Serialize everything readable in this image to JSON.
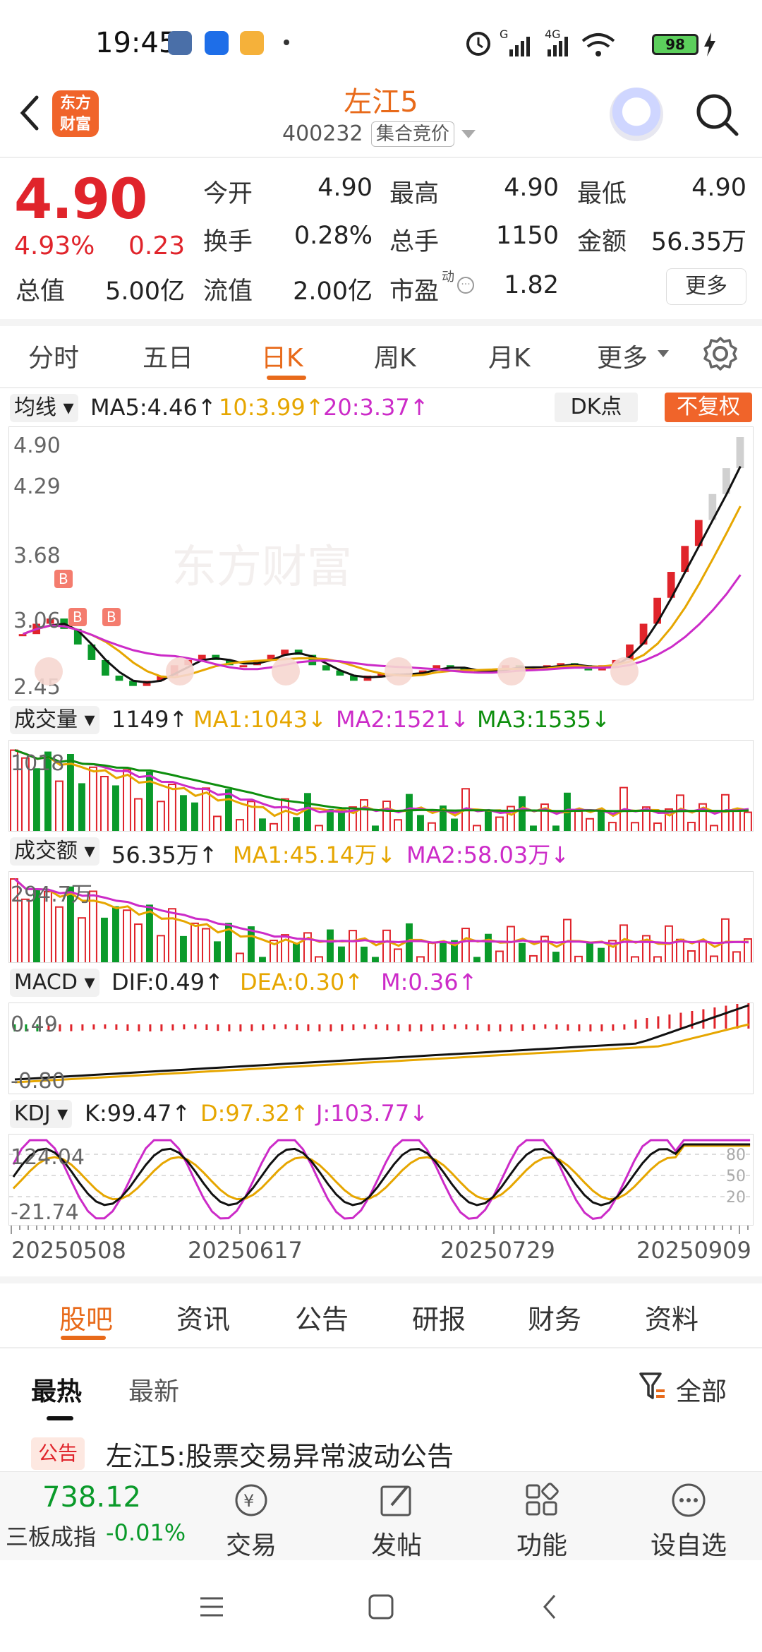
{
  "status_bar": {
    "time": "19:45",
    "battery": "98",
    "net1": "G",
    "net2": "4G"
  },
  "header": {
    "logo_text": [
      "东方",
      "财富"
    ],
    "stock_name": "左江5",
    "stock_code": "400232",
    "trading_mode": "集合竞价"
  },
  "quote": {
    "price": "4.90",
    "change_pct": "4.93%",
    "change_val": "0.23",
    "rows": [
      [
        {
          "label": "今开",
          "value": "4.90",
          "color": "red"
        },
        {
          "label": "最高",
          "value": "4.90",
          "color": "red"
        },
        {
          "label": "最低",
          "value": "4.90",
          "color": "red"
        }
      ],
      [
        {
          "label": "换手",
          "value": "0.28%",
          "color": "dark"
        },
        {
          "label": "总手",
          "value": "1150",
          "color": "dark"
        },
        {
          "label": "金额",
          "value": "56.35万",
          "color": "dark"
        }
      ]
    ],
    "total_value_label": "总值",
    "total_value": "5.00亿",
    "float_value_label": "流值",
    "float_value": "2.00亿",
    "pe_label": "市盈",
    "pe_superscript": "动",
    "pe_value": "1.82",
    "more_label": "更多"
  },
  "period_tabs": [
    "分时",
    "五日",
    "日K",
    "周K",
    "月K",
    "更多"
  ],
  "period_active": "日K",
  "kline": {
    "ma_selector": "均线",
    "ma5": "MA5:4.46",
    "ma10": "10:3.99",
    "ma20": "20:3.37",
    "dk_label": "DK点",
    "adjust_label": "不复权",
    "y_labels": [
      "4.90",
      "4.29",
      "3.68",
      "3.06",
      "2.45"
    ],
    "watermark": "东方财富"
  },
  "volume": {
    "selector": "成交量",
    "value": "1149",
    "ma1": "MA1:1043",
    "ma2": "MA2:1521",
    "ma3": "MA3:1535",
    "y_label": "1018"
  },
  "amount": {
    "selector": "成交额",
    "value": "56.35万",
    "ma1": "MA1:45.14万",
    "ma2": "MA2:58.03万",
    "y_label": "294.7万"
  },
  "macd": {
    "selector": "MACD",
    "dif": "DIF:0.49",
    "dea": "DEA:0.30",
    "m": "M:0.36",
    "y_top": "0.49",
    "y_bottom": "-0.80"
  },
  "kdj": {
    "selector": "KDJ",
    "k": "K:99.47",
    "d": "D:97.32",
    "j": "J:103.77",
    "y_top": "124.04",
    "y_bottom": "-21.74",
    "levels": [
      "80",
      "50",
      "20"
    ]
  },
  "dates": [
    "20250508",
    "20250617",
    "20250729",
    "20250909"
  ],
  "bottom_tabs": [
    "股吧",
    "资讯",
    "公告",
    "研报",
    "财务",
    "资料"
  ],
  "bottom_active": "股吧",
  "sort_tabs": [
    "最热",
    "最新"
  ],
  "filter_label": "全部",
  "news": {
    "tag": "公告",
    "title": "左江5:股票交易异常波动公告"
  },
  "toolbar": {
    "index_value": "738.12",
    "index_name": "三板成指",
    "index_change": "-0.01%",
    "items": [
      "交易",
      "发帖",
      "功能",
      "设自选"
    ]
  },
  "chart_data": {
    "type": "candlestick",
    "price_axis": [
      2.45,
      4.9
    ],
    "close_estimates": [
      3.0,
      3.1,
      3.15,
      3.05,
      2.9,
      2.75,
      2.6,
      2.55,
      2.5,
      2.55,
      2.6,
      2.7,
      2.75,
      2.8,
      2.75,
      2.7,
      2.7,
      2.75,
      2.8,
      2.85,
      2.8,
      2.7,
      2.65,
      2.6,
      2.55,
      2.6,
      2.62,
      2.6,
      2.62,
      2.65,
      2.7,
      2.68,
      2.65,
      2.62,
      2.65,
      2.7,
      2.68,
      2.66,
      2.7,
      2.72,
      2.7,
      2.65,
      2.7,
      2.75,
      2.9,
      3.1,
      3.35,
      3.6,
      3.85,
      4.1,
      4.35,
      4.6,
      4.9
    ]
  }
}
